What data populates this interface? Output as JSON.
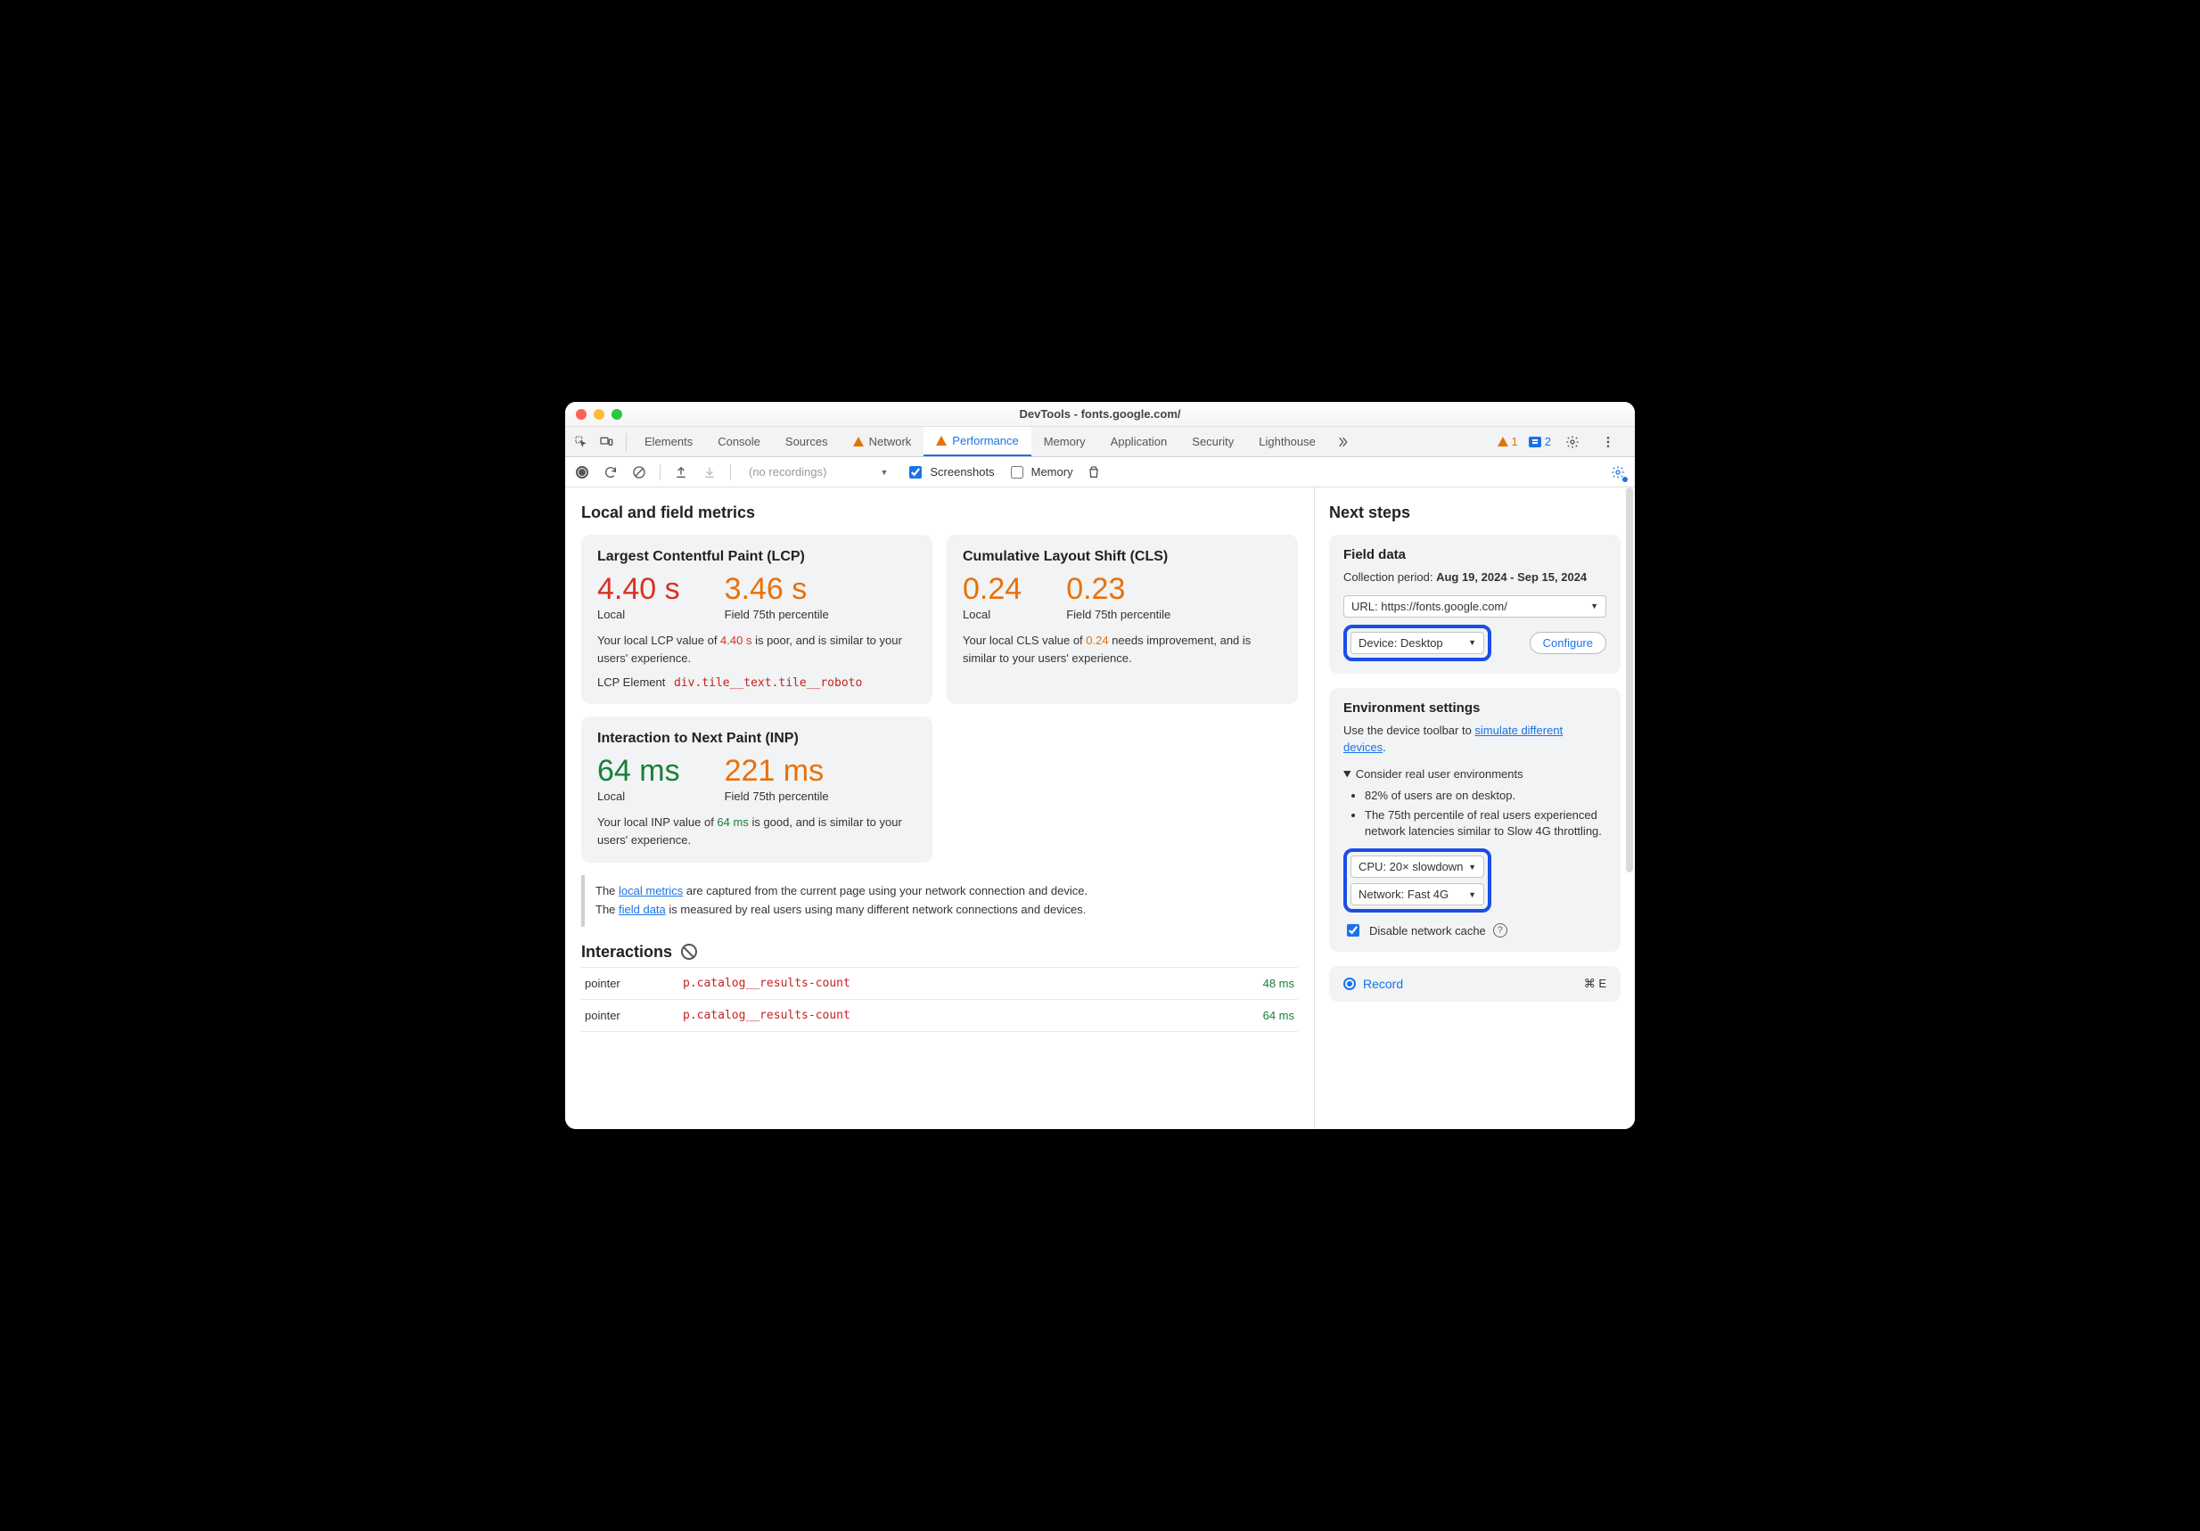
{
  "window": {
    "title": "DevTools - fonts.google.com/"
  },
  "tabstrip": {
    "tabs": [
      "Elements",
      "Console",
      "Sources",
      "Network",
      "Performance",
      "Memory",
      "Application",
      "Security",
      "Lighthouse"
    ],
    "active": "Performance",
    "warn_tabs": [
      "Network",
      "Performance"
    ],
    "warnings": "1",
    "messages": "2"
  },
  "toolbar": {
    "recordings_placeholder": "(no recordings)",
    "screenshots_label": "Screenshots",
    "memory_label": "Memory"
  },
  "sections": {
    "metrics_title": "Local and field metrics",
    "interactions_title": "Interactions",
    "next_steps_title": "Next steps"
  },
  "lcp": {
    "title": "Largest Contentful Paint (LCP)",
    "local": "4.40 s",
    "field": "3.46 s",
    "local_label": "Local",
    "field_label": "Field 75th percentile",
    "desc_pre": "Your local LCP value of ",
    "desc_val": "4.40 s",
    "desc_post": " is poor, and is similar to your users' experience.",
    "elem_label": "LCP Element",
    "elem_sel": "div.tile__text.tile__roboto"
  },
  "cls": {
    "title": "Cumulative Layout Shift (CLS)",
    "local": "0.24",
    "field": "0.23",
    "local_label": "Local",
    "field_label": "Field 75th percentile",
    "desc_pre": "Your local CLS value of ",
    "desc_val": "0.24",
    "desc_post": " needs improvement, and is similar to your users' experience."
  },
  "inp": {
    "title": "Interaction to Next Paint (INP)",
    "local": "64 ms",
    "field": "221 ms",
    "local_label": "Local",
    "field_label": "Field 75th percentile",
    "desc_pre": "Your local INP value of ",
    "desc_val": "64 ms",
    "desc_post": " is good, and is similar to your users' experience."
  },
  "note": {
    "line1_pre": "The ",
    "line1_link": "local metrics",
    "line1_post": " are captured from the current page using your network connection and device.",
    "line2_pre": "The ",
    "line2_link": "field data",
    "line2_post": " is measured by real users using many different network connections and devices."
  },
  "interactions": [
    {
      "type": "pointer",
      "selector": "p.catalog__results-count",
      "time": "48 ms"
    },
    {
      "type": "pointer",
      "selector": "p.catalog__results-count",
      "time": "64 ms"
    }
  ],
  "field_data": {
    "title": "Field data",
    "period_label": "Collection period: ",
    "period_value": "Aug 19, 2024 - Sep 15, 2024",
    "url_dd": "URL: https://fonts.google.com/",
    "device_dd": "Device: Desktop",
    "configure": "Configure"
  },
  "env": {
    "title": "Environment settings",
    "hint_pre": "Use the device toolbar to ",
    "hint_link": "simulate different devices",
    "hint_post": ".",
    "summary": "Consider real user environments",
    "bullet1": "82% of users are on desktop.",
    "bullet2": "The 75th percentile of real users experienced network latencies similar to Slow 4G throttling.",
    "cpu_dd": "CPU: 20× slowdown",
    "net_dd": "Network: Fast 4G",
    "cache_label": "Disable network cache"
  },
  "record": {
    "label": "Record",
    "shortcut": "⌘ E"
  }
}
